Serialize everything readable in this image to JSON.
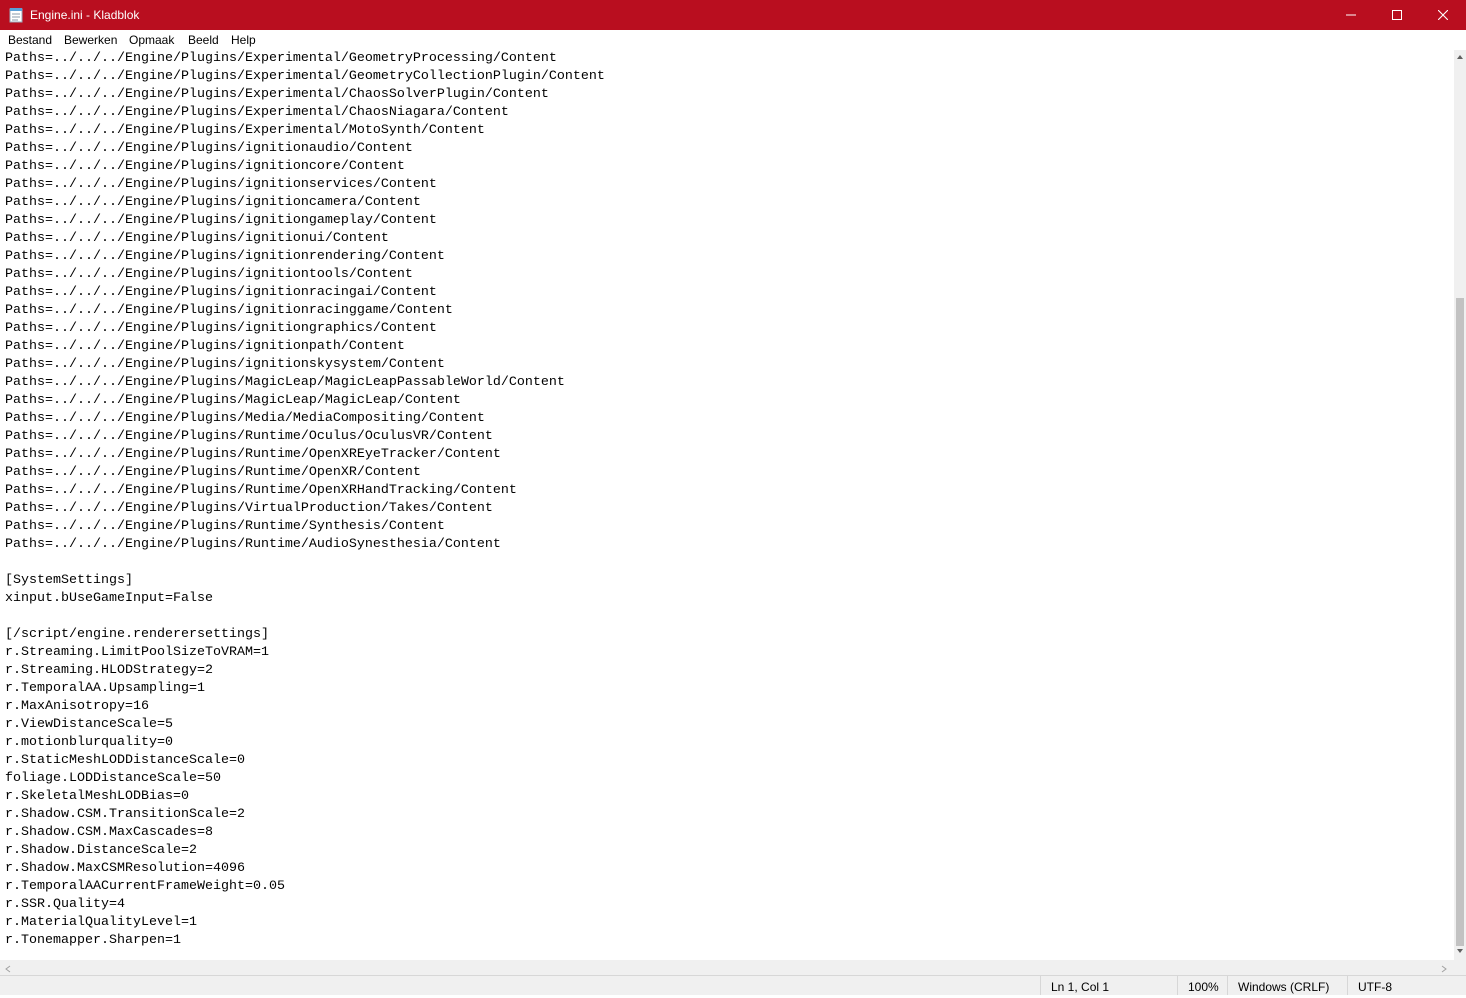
{
  "window": {
    "title": "Engine.ini - Kladblok"
  },
  "menu": {
    "items": [
      "Bestand",
      "Bewerken",
      "Opmaak",
      "Beeld",
      "Help"
    ]
  },
  "editor": {
    "lines": [
      "Paths=../../../Engine/Plugins/Experimental/GeometryProcessing/Content",
      "Paths=../../../Engine/Plugins/Experimental/GeometryCollectionPlugin/Content",
      "Paths=../../../Engine/Plugins/Experimental/ChaosSolverPlugin/Content",
      "Paths=../../../Engine/Plugins/Experimental/ChaosNiagara/Content",
      "Paths=../../../Engine/Plugins/Experimental/MotoSynth/Content",
      "Paths=../../../Engine/Plugins/ignitionaudio/Content",
      "Paths=../../../Engine/Plugins/ignitioncore/Content",
      "Paths=../../../Engine/Plugins/ignitionservices/Content",
      "Paths=../../../Engine/Plugins/ignitioncamera/Content",
      "Paths=../../../Engine/Plugins/ignitiongameplay/Content",
      "Paths=../../../Engine/Plugins/ignitionui/Content",
      "Paths=../../../Engine/Plugins/ignitionrendering/Content",
      "Paths=../../../Engine/Plugins/ignitiontools/Content",
      "Paths=../../../Engine/Plugins/ignitionracingai/Content",
      "Paths=../../../Engine/Plugins/ignitionracinggame/Content",
      "Paths=../../../Engine/Plugins/ignitiongraphics/Content",
      "Paths=../../../Engine/Plugins/ignitionpath/Content",
      "Paths=../../../Engine/Plugins/ignitionskysystem/Content",
      "Paths=../../../Engine/Plugins/MagicLeap/MagicLeapPassableWorld/Content",
      "Paths=../../../Engine/Plugins/MagicLeap/MagicLeap/Content",
      "Paths=../../../Engine/Plugins/Media/MediaCompositing/Content",
      "Paths=../../../Engine/Plugins/Runtime/Oculus/OculusVR/Content",
      "Paths=../../../Engine/Plugins/Runtime/OpenXREyeTracker/Content",
      "Paths=../../../Engine/Plugins/Runtime/OpenXR/Content",
      "Paths=../../../Engine/Plugins/Runtime/OpenXRHandTracking/Content",
      "Paths=../../../Engine/Plugins/VirtualProduction/Takes/Content",
      "Paths=../../../Engine/Plugins/Runtime/Synthesis/Content",
      "Paths=../../../Engine/Plugins/Runtime/AudioSynesthesia/Content",
      "",
      "[SystemSettings]",
      "xinput.bUseGameInput=False",
      "",
      "[/script/engine.renderersettings]",
      "r.Streaming.LimitPoolSizeToVRAM=1",
      "r.Streaming.HLODStrategy=2",
      "r.TemporalAA.Upsampling=1",
      "r.MaxAnisotropy=16",
      "r.ViewDistanceScale=5",
      "r.motionblurquality=0",
      "r.StaticMeshLODDistanceScale=0",
      "foliage.LODDistanceScale=50",
      "r.SkeletalMeshLODBias=0",
      "r.Shadow.CSM.TransitionScale=2",
      "r.Shadow.CSM.MaxCascades=8",
      "r.Shadow.DistanceScale=2",
      "r.Shadow.MaxCSMResolution=4096",
      "r.TemporalAACurrentFrameWeight=0.05",
      "r.SSR.Quality=4",
      "r.MaterialQualityLevel=1",
      "r.Tonemapper.Sharpen=1"
    ]
  },
  "status": {
    "position": "Ln 1, Col 1",
    "zoom": "100%",
    "line_endings": "Windows (CRLF)",
    "encoding": "UTF-8"
  },
  "colors": {
    "titlebar": "#b90e1f",
    "statusbar": "#f0f0f0"
  }
}
